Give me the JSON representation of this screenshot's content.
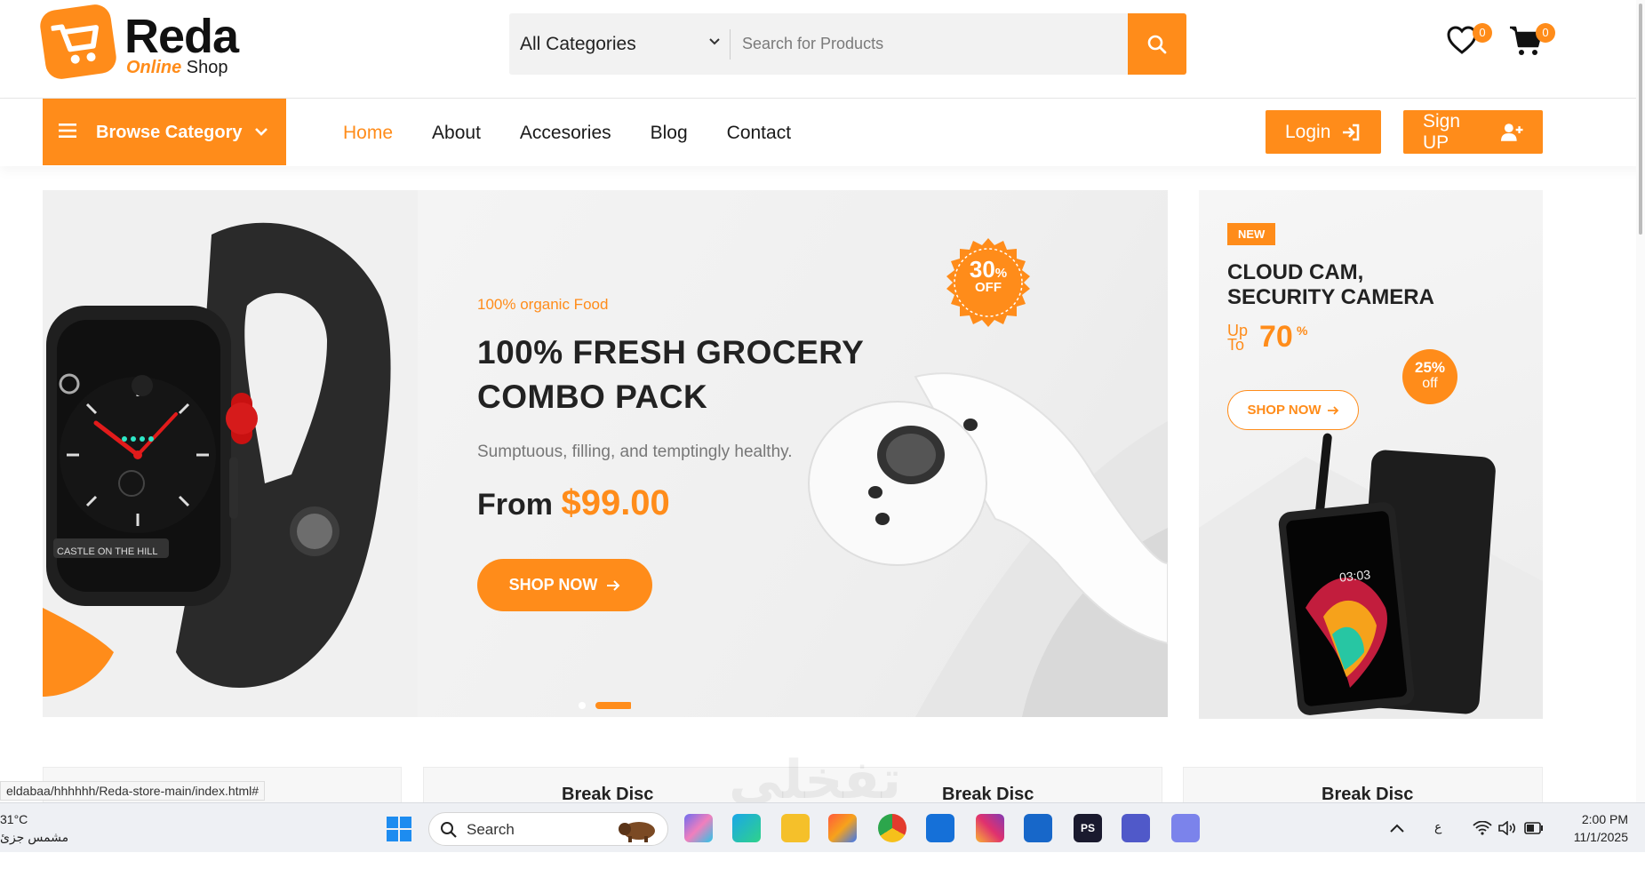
{
  "brand": {
    "name": "Reda",
    "sub_accent": "Online",
    "sub_rest": "Shop",
    "accent_color": "#ff8c1a"
  },
  "search": {
    "category": "All Categories",
    "placeholder": "Search for Products"
  },
  "header_icons": {
    "wishlist_count": "0",
    "cart_count": "0"
  },
  "nav": {
    "browse_label": "Browse Category",
    "links": [
      "Home",
      "About",
      "Accesories",
      "Blog",
      "Contact"
    ],
    "active": "Home",
    "login": "Login",
    "signup": "Sign UP"
  },
  "hero": {
    "subtitle": "100% organic Food",
    "title_line1": "100% FRESH GROCERY",
    "title_line2": "COMBO PACK",
    "description": "Sumptuous, filling, and temptingly healthy.",
    "price_prefix": "From",
    "price": "$99.00",
    "cta": "SHOP NOW",
    "seal_value": "30",
    "seal_pct": "%",
    "seal_off": "OFF",
    "watch_text": "CASTLE ON THE HILL"
  },
  "side_banner": {
    "badge": "NEW",
    "title_line1": "CLOUD CAM,",
    "title_line2": "SECURITY CAMERA",
    "upto_1": "Up",
    "upto_2": "To",
    "discount": "70",
    "pct": "%",
    "circle_value": "25%",
    "circle_off": "off",
    "cta": "SHOP NOW",
    "phone_time": "03:03"
  },
  "product_cards": [
    {
      "title": "Break Disc"
    },
    {
      "title": "Break Disc"
    },
    {
      "title": "Break Disc"
    }
  ],
  "watermark": "تفخلي",
  "status_url": "eldabaa/hhhhhh/Reda-store-main/index.html#",
  "taskbar": {
    "weather_temp": "31°C",
    "weather_desc": "مشمس جزئ",
    "search_label": "Search",
    "lang": "ع",
    "time": "2:00 PM",
    "date": "11/1/2025",
    "ps_label": "PS"
  }
}
